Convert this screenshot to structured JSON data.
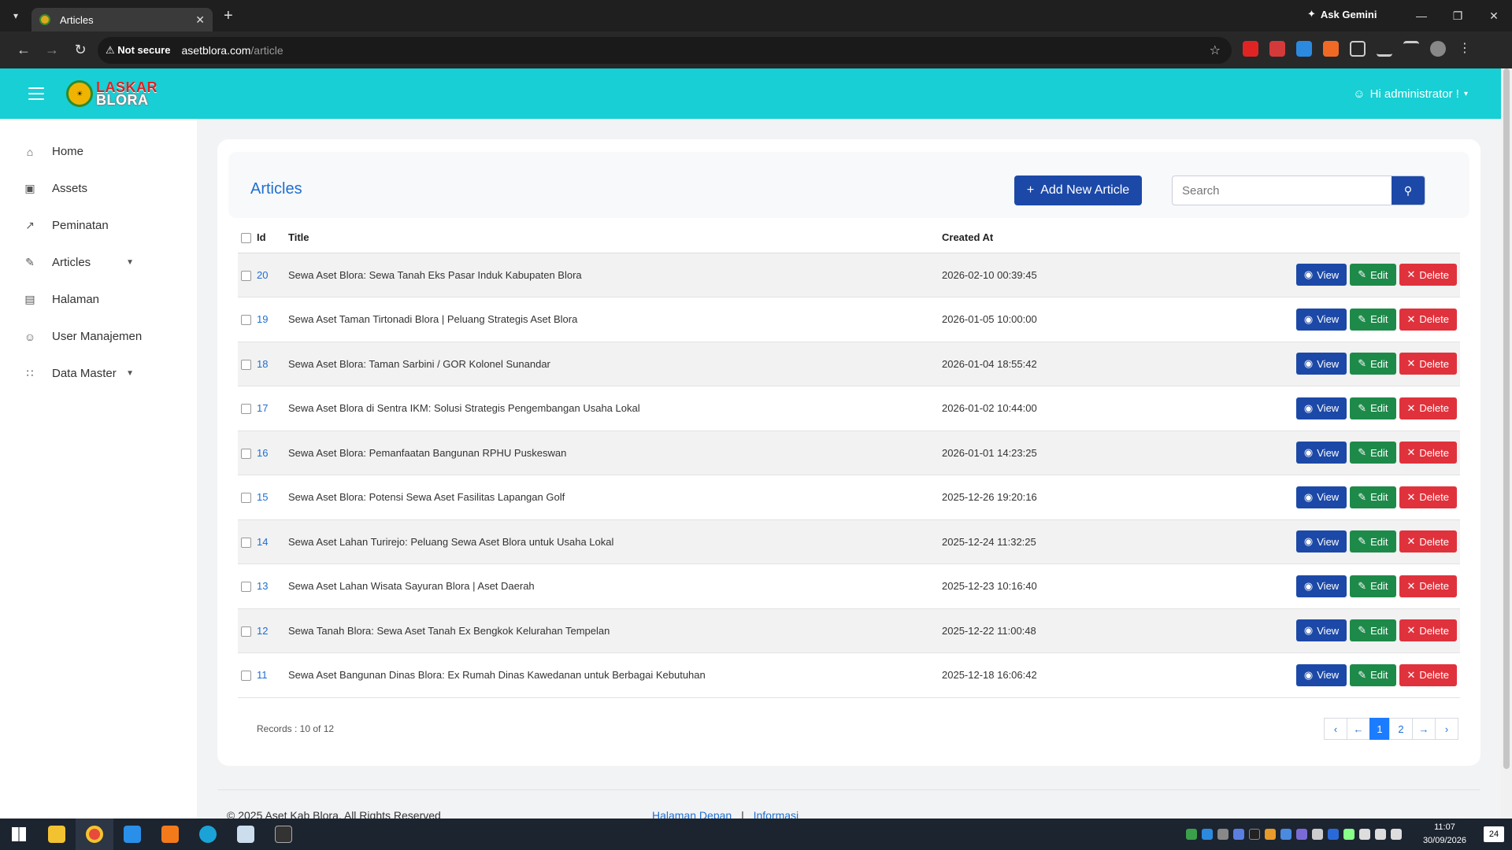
{
  "browser": {
    "tab_title": "Articles",
    "ask_gemini": "Ask Gemini",
    "security": "Not secure",
    "url_host": "asetblora.com",
    "url_path": "/article"
  },
  "app": {
    "logo_line1": "LASKAR",
    "logo_line2": "BLORA",
    "user_menu": "Hi administrator !"
  },
  "sidebar": {
    "items": [
      {
        "label": "Home"
      },
      {
        "label": "Assets"
      },
      {
        "label": "Peminatan"
      },
      {
        "label": "Articles"
      },
      {
        "label": "Halaman"
      },
      {
        "label": "User Manajemen"
      },
      {
        "label": "Data Master"
      }
    ]
  },
  "page": {
    "title": "Articles",
    "add_button": "Add New Article",
    "search_placeholder": "Search"
  },
  "table": {
    "headers": {
      "id": "Id",
      "title": "Title",
      "created": "Created At"
    },
    "actions": {
      "view": "View",
      "edit": "Edit",
      "delete": "Delete"
    },
    "rows": [
      {
        "id": "20",
        "title": "Sewa Aset Blora: Sewa Tanah Eks Pasar Induk Kabupaten Blora",
        "created": "2026-02-10 00:39:45"
      },
      {
        "id": "19",
        "title": "Sewa Aset Taman Tirtonadi Blora | Peluang Strategis Aset Blora",
        "created": "2026-01-05 10:00:00"
      },
      {
        "id": "18",
        "title": "Sewa Aset Blora: Taman Sarbini / GOR Kolonel Sunandar",
        "created": "2026-01-04 18:55:42"
      },
      {
        "id": "17",
        "title": "Sewa Aset Blora di Sentra IKM: Solusi Strategis Pengembangan Usaha Lokal",
        "created": "2026-01-02 10:44:00"
      },
      {
        "id": "16",
        "title": "Sewa Aset Blora: Pemanfaatan Bangunan RPHU Puskeswan",
        "created": "2026-01-01 14:23:25"
      },
      {
        "id": "15",
        "title": "Sewa Aset Blora: Potensi Sewa Aset Fasilitas Lapangan Golf",
        "created": "2025-12-26 19:20:16"
      },
      {
        "id": "14",
        "title": "Sewa Aset Lahan Turirejo: Peluang Sewa Aset Blora untuk Usaha Lokal",
        "created": "2025-12-24 11:32:25"
      },
      {
        "id": "13",
        "title": "Sewa Aset Lahan Wisata Sayuran Blora | Aset Daerah",
        "created": "2025-12-23 10:16:40"
      },
      {
        "id": "12",
        "title": "Sewa Tanah Blora: Sewa Aset Tanah Ex Bengkok Kelurahan Tempelan",
        "created": "2025-12-22 11:00:48"
      },
      {
        "id": "11",
        "title": "Sewa Aset Bangunan Dinas Blora: Ex Rumah Dinas Kawedanan untuk Berbagai Kebutuhan",
        "created": "2025-12-18 16:06:42"
      }
    ]
  },
  "pagination": {
    "records": "Records : 10 of 12",
    "first": "‹",
    "prev": "←",
    "pages": [
      "1",
      "2"
    ],
    "next": "→",
    "last": "›"
  },
  "footer": {
    "copyright": "© 2025 Aset Kab Blora. All Rights Reserved",
    "link1": "Halaman Depan",
    "separator": "|",
    "link2": "Informasi"
  },
  "taskbar": {
    "time": "11:07",
    "date": "30/09/2026",
    "notifications": "24"
  }
}
